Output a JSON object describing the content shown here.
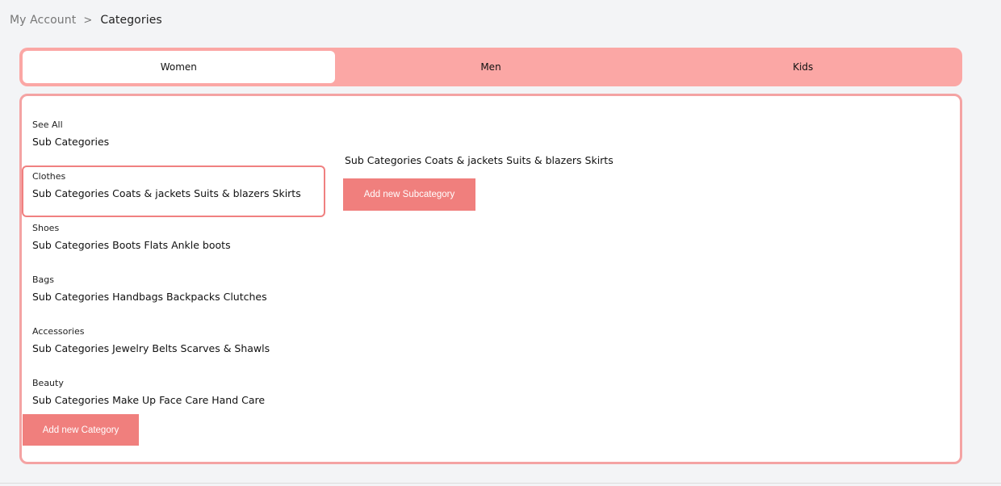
{
  "breadcrumb": {
    "root": "My Account",
    "separator": ">",
    "current": "Categories"
  },
  "tabs": [
    {
      "label": "Women",
      "active": true
    },
    {
      "label": "Men",
      "active": false
    },
    {
      "label": "Kids",
      "active": false
    }
  ],
  "categories": [
    {
      "name": "See All",
      "subs": "Sub Categories"
    },
    {
      "name": "Clothes",
      "subs": "Sub Categories Coats & jackets Suits & blazers Skirts",
      "selected": true
    },
    {
      "name": "Shoes",
      "subs": "Sub Categories Boots Flats Ankle boots"
    },
    {
      "name": "Bags",
      "subs": "Sub Categories Handbags Backpacks Clutches"
    },
    {
      "name": "Accessories",
      "subs": "Sub Categories Jewelry Belts Scarves & Shawls"
    },
    {
      "name": "Beauty",
      "subs": "Sub Categories Make Up Face Care Hand Care"
    }
  ],
  "add_category_label": "Add new Category",
  "detail": {
    "subs": "Sub Categories Coats & jackets Suits & blazers Skirts",
    "add_subcategory_label": "Add new Subcategory"
  },
  "colors": {
    "accent": "#f07f7d",
    "tab_bar": "#fba7a5",
    "panel_border": "#f4a3a3",
    "background": "#f3f4f6"
  }
}
